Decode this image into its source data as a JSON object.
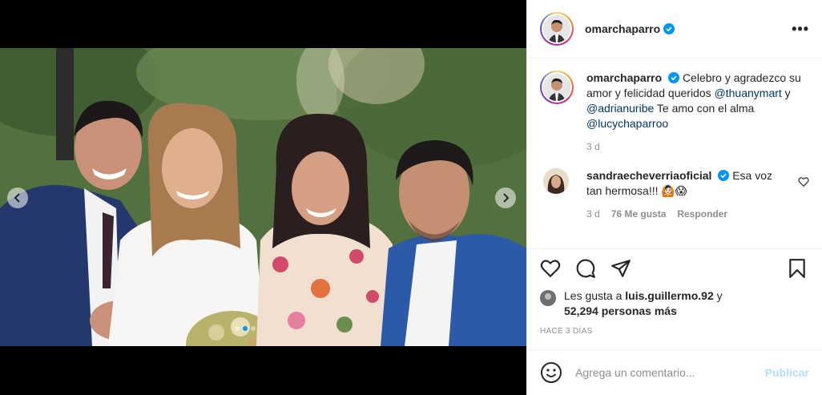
{
  "post": {
    "author": "omarchaparro",
    "more_label": "•••"
  },
  "caption": {
    "username": "omarchaparro",
    "text_1": "Celebro y agradezco su amor y felicidad queridos ",
    "mention_1": "@thuanymart",
    "text_2": " y ",
    "mention_2": "@adrianuribe",
    "text_3": " Te amo con el alma ",
    "mention_3": "@lucychaparroo",
    "age": "3 d"
  },
  "comment": {
    "username": "sandraecheverriaoficial",
    "text": "Esa voz tan hermosa!!!",
    "emojis": "🙆🏻😱",
    "age": "3 d",
    "likes": "76 Me gusta",
    "reply_label": "Responder"
  },
  "likes": {
    "prefix": "Les gusta a ",
    "user": "luis.guillermo.92",
    "middle": " y ",
    "others": "52,294 personas más"
  },
  "timestamp": "HACE 3 DÍAS",
  "add_comment": {
    "placeholder": "Agrega un comentario...",
    "publish_label": "Publicar"
  },
  "carousel": {
    "slide_count": 3,
    "active_index": 1
  },
  "colors": {
    "verified": "#0095f6",
    "mention": "#00376b",
    "publish_disabled": "#b2dffc"
  }
}
